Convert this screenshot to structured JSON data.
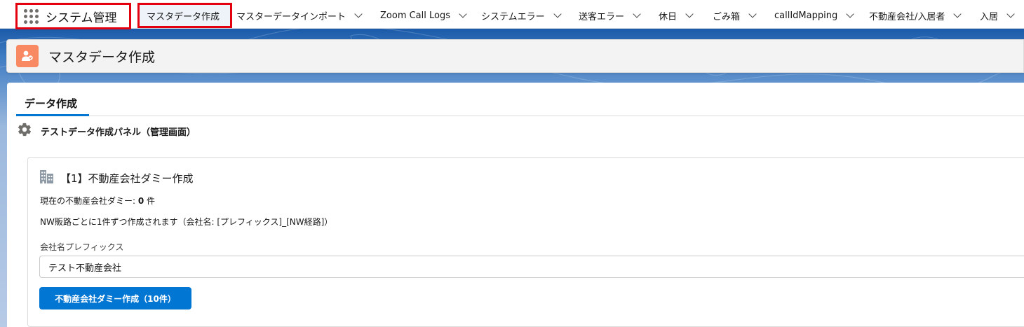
{
  "app": {
    "name": "システム管理"
  },
  "nav": {
    "tabs": [
      {
        "label": "マスタデータ作成",
        "has_menu": false
      },
      {
        "label": "マスターデータインポート",
        "has_menu": true
      },
      {
        "label": "Zoom Call Logs",
        "has_menu": true
      },
      {
        "label": "システムエラー",
        "has_menu": true
      },
      {
        "label": "送客エラー",
        "has_menu": true
      },
      {
        "label": "休日",
        "has_menu": true
      },
      {
        "label": "ごみ箱",
        "has_menu": true
      },
      {
        "label": "callIdMapping",
        "has_menu": true
      },
      {
        "label": "不動産会社/入居者",
        "has_menu": true
      },
      {
        "label": "入居",
        "has_menu": true
      }
    ]
  },
  "page": {
    "title": "マスタデータ作成",
    "icon": "user-record-icon",
    "icon_color": "#f88962"
  },
  "tabset": {
    "active_tab": "データ作成"
  },
  "panel": {
    "icon": "gear-icon",
    "title": "テストデータ作成パネル（管理画面）"
  },
  "section1": {
    "icon": "building-icon",
    "title": "【1】不動産会社ダミー作成",
    "count_label": "現在の不動産会社ダミー: ",
    "count_value": "0",
    "count_unit": " 件",
    "note": "NW販路ごとに1件ずつ作成されます（会社名: [プレフィックス]_[NW経路]）",
    "field_label": "会社名プレフィックス",
    "field_value": "テスト不動産会社",
    "button_label": "不動産会社ダミー作成（10件）"
  },
  "colors": {
    "brand": "#0176d3",
    "highlight": "#e3000f",
    "page_icon": "#f88962"
  }
}
